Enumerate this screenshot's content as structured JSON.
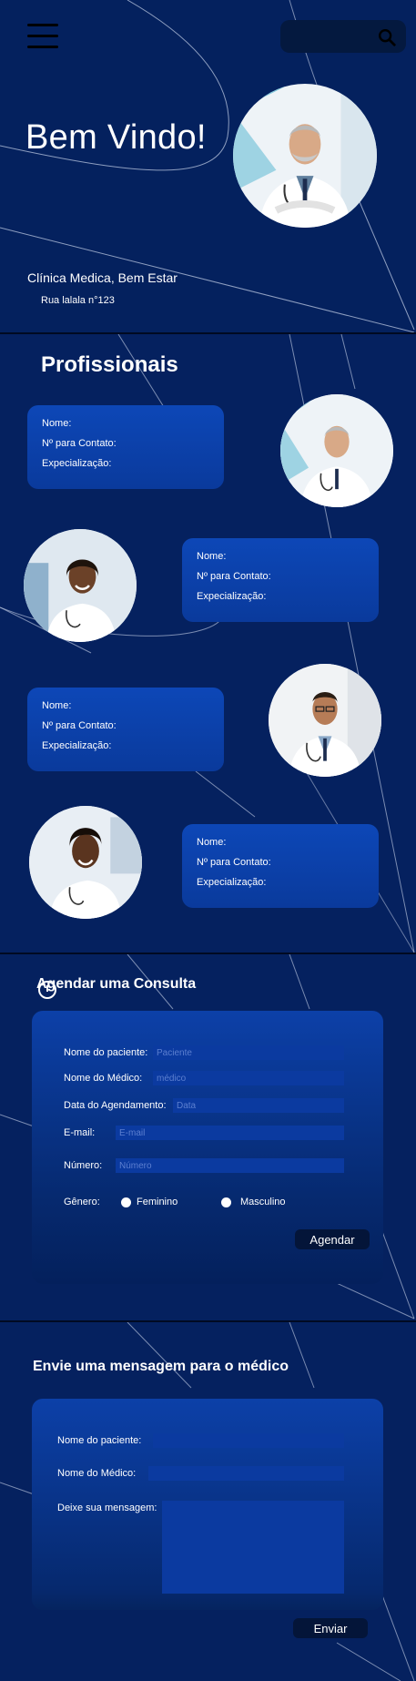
{
  "header": {
    "menu_icon": "hamburger-menu-icon",
    "search_icon": "search-icon",
    "search_placeholder": "",
    "title": "Bem Vindo!",
    "subtitle": "Clínica Medica, Bem Estar",
    "address": "Rua lalala n°123"
  },
  "professionals": {
    "title": "Profissionais",
    "cards": [
      {
        "name_label": "Nome:",
        "contact_label": "Nº para Contato:",
        "spec_label": "Expecialização:"
      },
      {
        "name_label": "Nome:",
        "contact_label": "Nº para Contato:",
        "spec_label": "Expecialização:"
      },
      {
        "name_label": "Nome:",
        "contact_label": "Nº para Contato:",
        "spec_label": "Expecialização:"
      },
      {
        "name_label": "Nome:",
        "contact_label": "Nº para Contato:",
        "spec_label": "Expecialização:"
      }
    ]
  },
  "appointment": {
    "title": "Agendar uma Consulta",
    "clock_icon": "clock-icon",
    "fields": [
      {
        "label": "Nome do paciente:",
        "placeholder": "Paciente"
      },
      {
        "label": "Nome do Médico:",
        "placeholder": "médico"
      },
      {
        "label": "Data do Agendamento:",
        "placeholder": "Data"
      },
      {
        "label": "E-mail:",
        "placeholder": "E-mail"
      },
      {
        "label": "Número:",
        "placeholder": "Número"
      }
    ],
    "gender_label": "Gênero:",
    "gender_options": [
      "Feminino",
      "Masculino"
    ],
    "submit_label": "Agendar"
  },
  "message": {
    "title": "Envie uma mensagem para o médico",
    "fields": [
      {
        "label": "Nome do paciente:"
      },
      {
        "label": "Nome do Médico:"
      }
    ],
    "message_label": "Deixe sua mensagem:",
    "submit_label": "Enviar"
  },
  "colors": {
    "background": "#05215f",
    "card": "#0d47b7",
    "input": "#0b3aa0",
    "button": "#041539"
  }
}
